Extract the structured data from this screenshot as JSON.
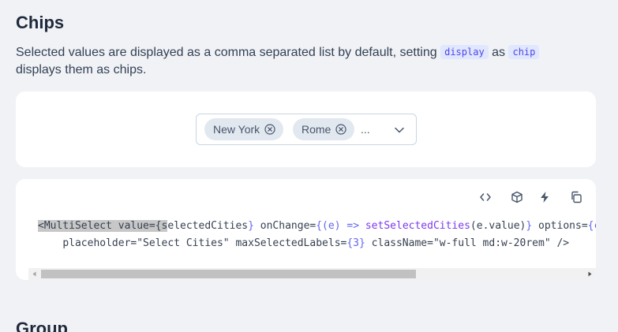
{
  "section": {
    "title": "Chips",
    "description_pre": "Selected values are displayed as a comma separated list by default, setting",
    "code_display": "display",
    "description_mid": "as",
    "code_chip": "chip",
    "description_post": "displays them as chips."
  },
  "multiselect": {
    "chips": [
      {
        "label": "New York"
      },
      {
        "label": "Rome"
      }
    ],
    "overflow_indicator": "...",
    "icons": {
      "chip_remove": "times-circle-icon",
      "dropdown": "chevron-down-icon"
    }
  },
  "code_toolbar": {
    "icons": [
      "code-icon",
      "box-icon",
      "bolt-icon",
      "copy-icon"
    ]
  },
  "code": {
    "line1_highlighted": "<MultiSelect value={s",
    "line1_var": "electedCities",
    "line1_b1": "}",
    "line1_attr2": " onChange=",
    "line1_b2": "{(e) =>",
    "line1_fn": " setSelectedCities",
    "line1_args": "(e.value)",
    "line1_b3": "}",
    "line1_attr3": " options=",
    "line1_b4": "{ci",
    "line2_indent": "    ",
    "line2_attr1": "placeholder=",
    "line2_str1": "\"Select Cities\"",
    "line2_attr2": " maxSelectedLabels=",
    "line2_num": "{3}",
    "line2_attr3": " className=",
    "line2_str2": "\"w-full md:w-20rem\"",
    "line2_end": " />"
  },
  "next_section": {
    "title": "Group"
  }
}
